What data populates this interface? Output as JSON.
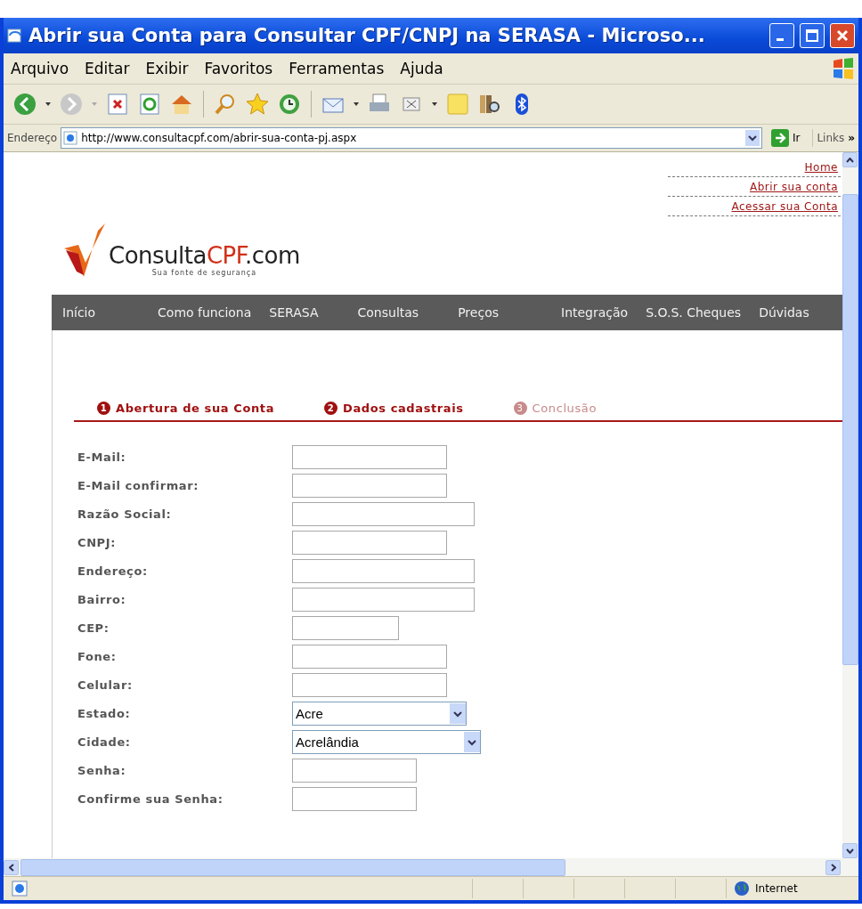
{
  "window": {
    "title": "Abrir sua Conta para Consultar CPF/CNPJ na SERASA - Microso..."
  },
  "menu": [
    "Arquivo",
    "Editar",
    "Exibir",
    "Favoritos",
    "Ferramentas",
    "Ajuda"
  ],
  "address_bar": {
    "label": "Endereço",
    "value": "http://www.consultacpf.com/abrir-sua-conta-pj.aspx",
    "go": "Ir",
    "links": "Links",
    "more": "»"
  },
  "site": {
    "logo": {
      "name_start": "Consulta",
      "name_accent": "CPF",
      "name_end": ".com",
      "tagline": "Sua fonte de segurança"
    },
    "top_links": [
      "Home",
      "Abrir sua conta",
      "Acessar sua Conta"
    ],
    "nav": [
      "Início",
      "Como funciona",
      "SERASA",
      "Consultas",
      "Preços",
      "Integração",
      "S.O.S. Cheques",
      "Dúvidas"
    ],
    "steps": [
      {
        "number": "1",
        "label": "Abertura de sua Conta",
        "selected": true
      },
      {
        "number": "2",
        "label": "Dados cadastrais",
        "selected": true
      },
      {
        "number": "3",
        "label": "Conclusão",
        "selected": false
      }
    ],
    "form": [
      {
        "label": "E-Mail:",
        "kind": "text"
      },
      {
        "label": "E-Mail confirmar:",
        "kind": "text"
      },
      {
        "label": "Razão Social:",
        "kind": "text"
      },
      {
        "label": "CNPJ:",
        "kind": "text"
      },
      {
        "label": "Endereço:",
        "kind": "text"
      },
      {
        "label": "Bairro:",
        "kind": "text"
      },
      {
        "label": "CEP:",
        "kind": "text"
      },
      {
        "label": "Fone:",
        "kind": "text"
      },
      {
        "label": "Celular:",
        "kind": "text"
      },
      {
        "label": "Estado:",
        "kind": "select",
        "value": "Acre"
      },
      {
        "label": "Cidade:",
        "kind": "select",
        "value": "Acrelândia"
      },
      {
        "label": "Senha:",
        "kind": "password"
      },
      {
        "label": "Confirme sua Senha:",
        "kind": "password"
      }
    ]
  },
  "status_bar": {
    "zone": "Internet"
  }
}
